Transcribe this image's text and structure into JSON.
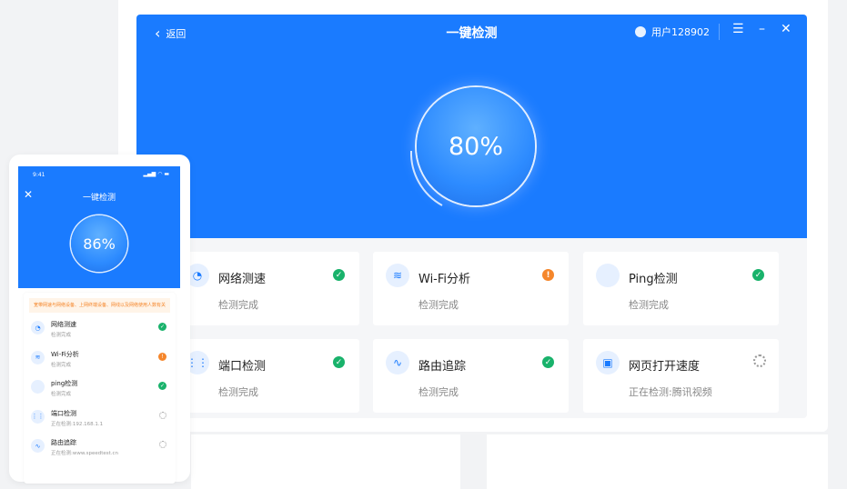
{
  "desktop": {
    "back_label": "返回",
    "title": "一键检测",
    "user": "用户128902",
    "progress": "80%",
    "items": [
      {
        "name": "网络测速",
        "status": "检测完成",
        "state": "ok",
        "icon": "speedometer-icon"
      },
      {
        "name": "Wi-Fi分析",
        "status": "检测完成",
        "state": "warn",
        "icon": "wifi-icon"
      },
      {
        "name": "Ping检测",
        "status": "检测完成",
        "state": "ok",
        "icon": "code-icon"
      },
      {
        "name": "端口检测",
        "status": "检测完成",
        "state": "ok",
        "icon": "port-icon"
      },
      {
        "name": "路由追踪",
        "status": "检测完成",
        "state": "ok",
        "icon": "route-icon"
      },
      {
        "name": "网页打开速度",
        "status": "正在检测:腾讯视频",
        "state": "loading",
        "icon": "webpage-icon"
      }
    ]
  },
  "mobile": {
    "time": "9:41",
    "title": "一键检测",
    "progress": "86%",
    "notice": "宽带网速与网络设备、上网终端设备、网线以及网络使用人数有关",
    "items": [
      {
        "name": "网络测速",
        "status": "检测完成",
        "state": "ok"
      },
      {
        "name": "Wi-Fi分析",
        "status": "检测完成",
        "state": "warn"
      },
      {
        "name": "ping检测",
        "status": "检测完成",
        "state": "ok"
      },
      {
        "name": "端口检测",
        "status": "正在检测:192.168.1.1",
        "state": "loading"
      },
      {
        "name": "路由追踪",
        "status": "正在检测:www.speedtest.cn",
        "state": "loading"
      }
    ]
  },
  "colors": {
    "primary": "#1a7bff",
    "ok": "#19b26b",
    "warn": "#f5862b"
  }
}
